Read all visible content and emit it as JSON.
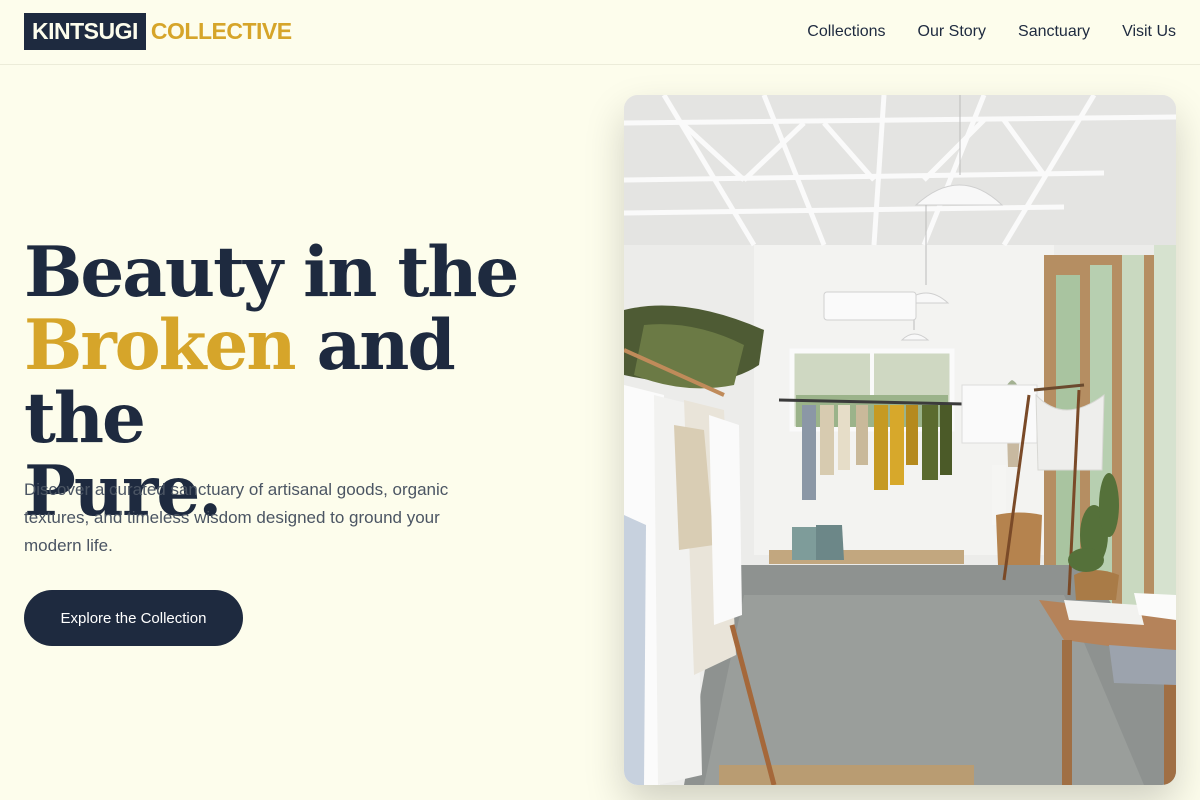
{
  "brand": {
    "name_dark": "KINTSUGI",
    "name_gold": "COLLECTIVE"
  },
  "nav": {
    "items": [
      {
        "label": "Collections"
      },
      {
        "label": "Our Story"
      },
      {
        "label": "Sanctuary"
      },
      {
        "label": "Visit Us"
      }
    ]
  },
  "hero": {
    "headline_line1": "Beauty in the",
    "headline_gold": "Broken",
    "headline_line2_rest": " and the",
    "headline_line3": "Pure.",
    "description": "Discover a curated sanctuary of artisanal goods, organic textures, and timeless wisdom designed to ground your modern life.",
    "cta_label": "Explore the Collection"
  },
  "colors": {
    "background": "#fdfdec",
    "navy": "#1e2a3f",
    "gold": "#d6a52a",
    "muted_text": "#4b5563"
  }
}
